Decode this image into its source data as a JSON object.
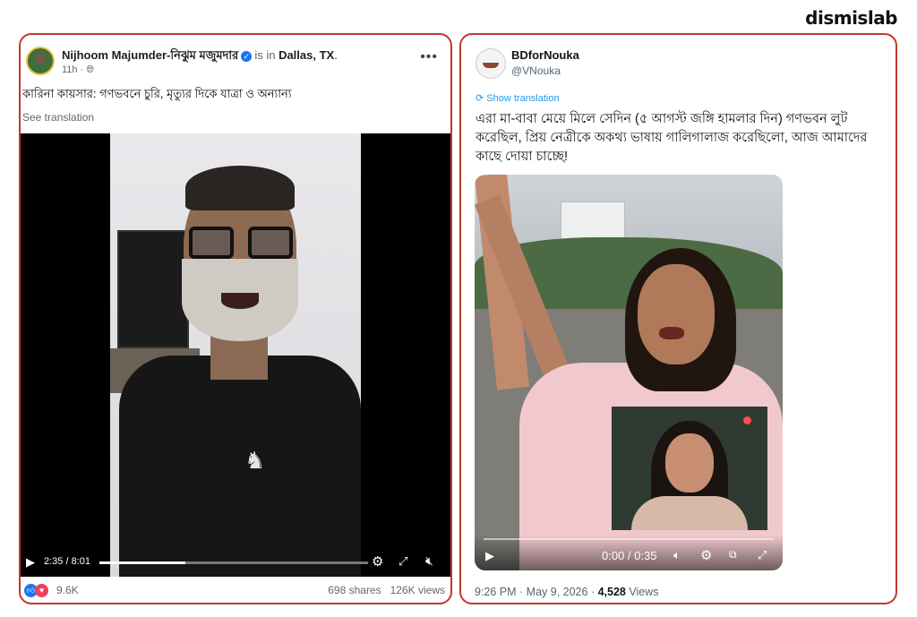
{
  "brand": "dismislab",
  "facebook_post": {
    "author_name": "Nijhoom Majumder-",
    "author_name_bn": "নিঝুম মজুমদার",
    "location_prefix": "is in",
    "location": "Dallas, TX",
    "time_ago": "11h",
    "caption": "কারিনা কায়সার: গণভবনে চুরি, মৃত্যুর দিকে যাত্রা ও অন্যান্য",
    "see_translation": "See translation",
    "video": {
      "current_time": "2:35",
      "duration": "8:01",
      "progress": 0.32
    },
    "reactions_count": "9.6K",
    "shares": "698 shares",
    "views": "126K views"
  },
  "tweet": {
    "display_name": "BDforNouka",
    "handle": "@VNouka",
    "show_translation": "Show translation",
    "text": "এরা মা-বাবা মেয়ে মিলে সেদিন (৫ আগস্ট জঙ্গি হামলার দিন) গণভবন লুট করেছিল, প্রিয় নেত্রীকে অকথ্য ভাষায় গালিগালাজ করেছিলো, আজ আমাদের কাছে দোয়া চাচ্ছে!",
    "video": {
      "time": "0:00 / 0:35",
      "progress": 0.0
    },
    "time": "9:26 PM",
    "date": "May 9, 2026",
    "views_count": "4,528",
    "views_label": "Views"
  }
}
